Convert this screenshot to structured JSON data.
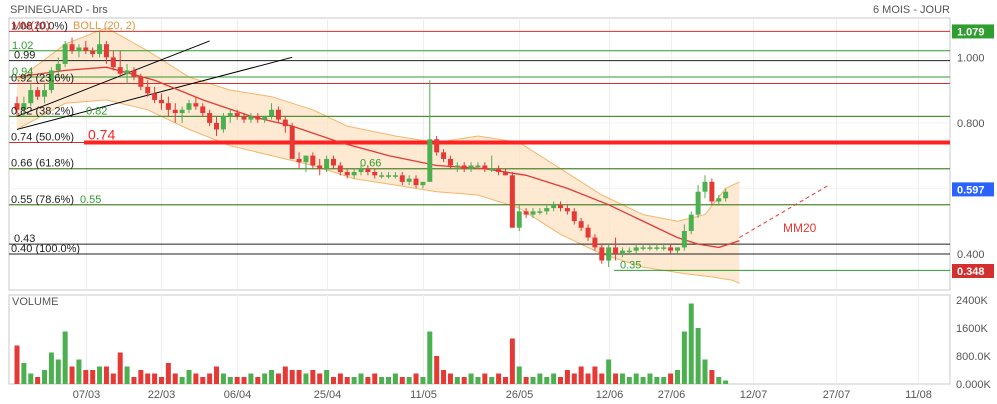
{
  "header": {
    "title": "SPINEGUARD - brs",
    "period": "6 MOIS - JOUR"
  },
  "legend": {
    "mm": "MM(20)",
    "boll": "BOLL (20, 2)"
  },
  "colors": {
    "up": "#4caf50",
    "down": "#e53935",
    "ma": "#e53935",
    "boll_fill": "#fde2c4",
    "boll_line": "#f4b66a",
    "fib": "#d32f2f",
    "support": "#2e9e2e",
    "axis_text": "#555555"
  },
  "price_axis": {
    "ticks": [
      1.0,
      0.8,
      0.6,
      0.4
    ],
    "tick_labels": [
      "1.000",
      "0.800",
      "0.600",
      "0.400"
    ],
    "markers": [
      {
        "label": "1.079",
        "value": 1.079,
        "color": "#2e9e2e"
      },
      {
        "label": "0.597",
        "value": 0.597,
        "color": "#2962ff"
      },
      {
        "label": "0.348",
        "value": 0.348,
        "color": "#d32f2f"
      }
    ]
  },
  "volume_axis": {
    "title": "VOLUME",
    "ticks": [
      0,
      800000,
      1600000,
      2400000
    ],
    "tick_labels": [
      "0.000K",
      "800.0K",
      "1600K",
      "2400K"
    ]
  },
  "dates": [
    "07/03",
    "22/03",
    "06/04",
    "25/04",
    "11/05",
    "26/05",
    "12/06",
    "27/06",
    "12/07",
    "27/07",
    "11/08"
  ],
  "fib_levels": [
    {
      "label": "1.08  (0.0%)",
      "value": 1.079
    },
    {
      "label": "0.92  (23.6%)",
      "value": 0.92
    },
    {
      "label": "0.82  (38.2%)",
      "value": 0.82
    },
    {
      "label": "0.74  (50.0%)",
      "value": 0.74
    },
    {
      "label": "0.66  (61.8%)",
      "value": 0.66
    },
    {
      "label": "0.55  (78.6%)",
      "value": 0.55
    },
    {
      "label": "0.40  (100.0%)",
      "value": 0.4
    }
  ],
  "horizontal_levels": [
    {
      "label": "1.02",
      "value": 1.02,
      "type": "support"
    },
    {
      "label": "0.99",
      "value": 0.99,
      "type": "black"
    },
    {
      "label": "0.94",
      "value": 0.94,
      "type": "support"
    },
    {
      "label": "0.82",
      "value": 0.82,
      "type": "support"
    },
    {
      "label": "0.74",
      "value": 0.74,
      "type": "key"
    },
    {
      "label": "0.66",
      "value": 0.66,
      "type": "support"
    },
    {
      "label": "0.55",
      "value": 0.55,
      "type": "support"
    },
    {
      "label": "0.43",
      "value": 0.43,
      "type": "black"
    },
    {
      "label": "0.35",
      "value": 0.35,
      "type": "support"
    }
  ],
  "annotations": {
    "ma_label": "MM20"
  },
  "chart_data": {
    "type": "candlestick",
    "title": "SPINEGUARD - brs",
    "period": "6 MOIS - JOUR",
    "ylim": [
      0.29,
      1.12
    ],
    "x_tick_labels": [
      "07/03",
      "22/03",
      "06/04",
      "25/04",
      "11/05",
      "26/05",
      "12/06",
      "27/06",
      "12/07",
      "27/07",
      "11/08"
    ],
    "candles": [
      [
        0.86,
        0.88,
        0.82,
        0.84,
        1100000
      ],
      [
        0.84,
        0.88,
        0.82,
        0.86,
        600000
      ],
      [
        0.86,
        0.92,
        0.85,
        0.9,
        300000
      ],
      [
        0.9,
        0.91,
        0.87,
        0.88,
        200000
      ],
      [
        0.88,
        0.92,
        0.86,
        0.9,
        400000
      ],
      [
        0.9,
        0.97,
        0.89,
        0.96,
        900000
      ],
      [
        0.96,
        1.0,
        0.94,
        0.98,
        700000
      ],
      [
        0.98,
        1.05,
        0.97,
        1.04,
        1500000
      ],
      [
        1.04,
        1.06,
        1.01,
        1.02,
        500000
      ],
      [
        1.02,
        1.04,
        1.0,
        1.03,
        700000
      ],
      [
        1.03,
        1.05,
        1.01,
        1.02,
        400000
      ],
      [
        1.02,
        1.03,
        1.0,
        1.01,
        400000
      ],
      [
        1.01,
        1.08,
        1.0,
        1.04,
        500000
      ],
      [
        1.04,
        1.05,
        0.98,
        1.0,
        500000
      ],
      [
        1.0,
        1.02,
        0.96,
        0.97,
        300000
      ],
      [
        0.97,
        1.02,
        0.94,
        0.95,
        900000
      ],
      [
        0.95,
        0.98,
        0.92,
        0.96,
        500000
      ],
      [
        0.96,
        0.97,
        0.93,
        0.94,
        200000
      ],
      [
        0.94,
        0.95,
        0.9,
        0.91,
        400000
      ],
      [
        0.91,
        0.93,
        0.88,
        0.89,
        300000
      ],
      [
        0.89,
        0.91,
        0.86,
        0.87,
        300000
      ],
      [
        0.87,
        0.89,
        0.84,
        0.86,
        200000
      ],
      [
        0.86,
        0.88,
        0.82,
        0.84,
        600000
      ],
      [
        0.84,
        0.86,
        0.8,
        0.83,
        300000
      ],
      [
        0.83,
        0.85,
        0.8,
        0.84,
        200000
      ],
      [
        0.84,
        0.87,
        0.83,
        0.86,
        400000
      ],
      [
        0.86,
        0.88,
        0.84,
        0.85,
        300000
      ],
      [
        0.85,
        0.86,
        0.82,
        0.83,
        200000
      ],
      [
        0.83,
        0.84,
        0.79,
        0.8,
        300000
      ],
      [
        0.8,
        0.82,
        0.76,
        0.78,
        500000
      ],
      [
        0.78,
        0.83,
        0.77,
        0.82,
        300000
      ],
      [
        0.82,
        0.84,
        0.8,
        0.83,
        200000
      ],
      [
        0.83,
        0.84,
        0.81,
        0.82,
        200000
      ],
      [
        0.82,
        0.83,
        0.8,
        0.81,
        200000
      ],
      [
        0.81,
        0.83,
        0.8,
        0.82,
        300000
      ],
      [
        0.82,
        0.83,
        0.8,
        0.81,
        200000
      ],
      [
        0.81,
        0.82,
        0.8,
        0.82,
        300000
      ],
      [
        0.82,
        0.86,
        0.81,
        0.84,
        400000
      ],
      [
        0.84,
        0.85,
        0.8,
        0.81,
        300000
      ],
      [
        0.81,
        0.82,
        0.77,
        0.79,
        500000
      ],
      [
        0.79,
        0.8,
        0.72,
        0.69,
        400000
      ],
      [
        0.69,
        0.71,
        0.66,
        0.68,
        400000
      ],
      [
        0.68,
        0.7,
        0.65,
        0.7,
        300000
      ],
      [
        0.7,
        0.71,
        0.66,
        0.67,
        400000
      ],
      [
        0.67,
        0.69,
        0.64,
        0.66,
        300000
      ],
      [
        0.66,
        0.7,
        0.65,
        0.69,
        400000
      ],
      [
        0.69,
        0.7,
        0.66,
        0.67,
        200000
      ],
      [
        0.67,
        0.68,
        0.64,
        0.65,
        300000
      ],
      [
        0.65,
        0.66,
        0.63,
        0.64,
        200000
      ],
      [
        0.64,
        0.66,
        0.63,
        0.65,
        200000
      ],
      [
        0.65,
        0.67,
        0.64,
        0.66,
        300000
      ],
      [
        0.66,
        0.67,
        0.64,
        0.65,
        200000
      ],
      [
        0.65,
        0.66,
        0.63,
        0.64,
        300000
      ],
      [
        0.64,
        0.65,
        0.63,
        0.64,
        200000
      ],
      [
        0.64,
        0.65,
        0.63,
        0.64,
        200000
      ],
      [
        0.64,
        0.65,
        0.63,
        0.64,
        300000
      ],
      [
        0.64,
        0.65,
        0.61,
        0.62,
        200000
      ],
      [
        0.62,
        0.64,
        0.61,
        0.63,
        200000
      ],
      [
        0.63,
        0.64,
        0.6,
        0.61,
        300000
      ],
      [
        0.61,
        0.62,
        0.6,
        0.62,
        200000
      ],
      [
        0.62,
        0.93,
        0.62,
        0.75,
        1500000
      ],
      [
        0.75,
        0.76,
        0.7,
        0.71,
        800000
      ],
      [
        0.71,
        0.72,
        0.68,
        0.69,
        400000
      ],
      [
        0.69,
        0.7,
        0.66,
        0.67,
        300000
      ],
      [
        0.67,
        0.68,
        0.65,
        0.67,
        200000
      ],
      [
        0.67,
        0.68,
        0.65,
        0.66,
        200000
      ],
      [
        0.66,
        0.68,
        0.65,
        0.67,
        300000
      ],
      [
        0.67,
        0.68,
        0.66,
        0.67,
        200000
      ],
      [
        0.67,
        0.68,
        0.65,
        0.66,
        300000
      ],
      [
        0.66,
        0.7,
        0.65,
        0.66,
        200000
      ],
      [
        0.66,
        0.67,
        0.64,
        0.65,
        300000
      ],
      [
        0.65,
        0.66,
        0.64,
        0.64,
        200000
      ],
      [
        0.64,
        0.65,
        0.51,
        0.48,
        1300000
      ],
      [
        0.48,
        0.55,
        0.47,
        0.53,
        500000
      ],
      [
        0.53,
        0.54,
        0.51,
        0.52,
        200000
      ],
      [
        0.52,
        0.54,
        0.51,
        0.53,
        200000
      ],
      [
        0.53,
        0.54,
        0.52,
        0.53,
        300000
      ],
      [
        0.53,
        0.55,
        0.52,
        0.54,
        200000
      ],
      [
        0.54,
        0.56,
        0.53,
        0.55,
        300000
      ],
      [
        0.55,
        0.56,
        0.53,
        0.54,
        200000
      ],
      [
        0.54,
        0.55,
        0.52,
        0.53,
        400000
      ],
      [
        0.53,
        0.54,
        0.49,
        0.5,
        300000
      ],
      [
        0.5,
        0.51,
        0.47,
        0.48,
        500000
      ],
      [
        0.48,
        0.49,
        0.44,
        0.45,
        300000
      ],
      [
        0.45,
        0.46,
        0.41,
        0.42,
        500000
      ],
      [
        0.42,
        0.43,
        0.37,
        0.38,
        300000
      ],
      [
        0.38,
        0.43,
        0.36,
        0.42,
        700000
      ],
      [
        0.42,
        0.45,
        0.38,
        0.4,
        300000
      ],
      [
        0.4,
        0.42,
        0.39,
        0.41,
        300000
      ],
      [
        0.41,
        0.42,
        0.4,
        0.41,
        200000
      ],
      [
        0.41,
        0.43,
        0.4,
        0.42,
        300000
      ],
      [
        0.42,
        0.43,
        0.41,
        0.42,
        200000
      ],
      [
        0.42,
        0.43,
        0.41,
        0.42,
        300000
      ],
      [
        0.42,
        0.43,
        0.41,
        0.42,
        200000
      ],
      [
        0.42,
        0.43,
        0.41,
        0.42,
        200000
      ],
      [
        0.42,
        0.43,
        0.4,
        0.41,
        300000
      ],
      [
        0.41,
        0.42,
        0.4,
        0.42,
        400000
      ],
      [
        0.42,
        0.49,
        0.41,
        0.47,
        1500000
      ],
      [
        0.47,
        0.53,
        0.46,
        0.52,
        2300000
      ],
      [
        0.52,
        0.61,
        0.51,
        0.59,
        1600000
      ],
      [
        0.59,
        0.64,
        0.57,
        0.62,
        700000
      ],
      [
        0.62,
        0.63,
        0.55,
        0.56,
        400000
      ],
      [
        0.56,
        0.58,
        0.55,
        0.57,
        200000
      ],
      [
        0.57,
        0.6,
        0.56,
        0.59,
        100000
      ]
    ],
    "ma20": [
      [
        0,
        0.94
      ],
      [
        7,
        0.96
      ],
      [
        13,
        0.97
      ],
      [
        20,
        0.93
      ],
      [
        27,
        0.87
      ],
      [
        34,
        0.82
      ],
      [
        40,
        0.79
      ],
      [
        47,
        0.74
      ],
      [
        54,
        0.7
      ],
      [
        61,
        0.67
      ],
      [
        68,
        0.66
      ],
      [
        74,
        0.64
      ],
      [
        80,
        0.6
      ],
      [
        86,
        0.55
      ],
      [
        92,
        0.49
      ],
      [
        96,
        0.45
      ],
      [
        99,
        0.43
      ],
      [
        102,
        0.42
      ],
      [
        105,
        0.44
      ]
    ],
    "boll_upper": [
      [
        0,
        0.93
      ],
      [
        7,
        1.04
      ],
      [
        13,
        1.09
      ],
      [
        19,
        1.02
      ],
      [
        25,
        0.94
      ],
      [
        31,
        0.9
      ],
      [
        37,
        0.88
      ],
      [
        43,
        0.84
      ],
      [
        48,
        0.79
      ],
      [
        55,
        0.76
      ],
      [
        61,
        0.74
      ],
      [
        67,
        0.76
      ],
      [
        73,
        0.74
      ],
      [
        79,
        0.66
      ],
      [
        85,
        0.58
      ],
      [
        91,
        0.52
      ],
      [
        96,
        0.5
      ],
      [
        100,
        0.52
      ],
      [
        103,
        0.6
      ],
      [
        105,
        0.62
      ]
    ],
    "boll_lower": [
      [
        0,
        0.78
      ],
      [
        7,
        0.86
      ],
      [
        13,
        0.87
      ],
      [
        19,
        0.84
      ],
      [
        25,
        0.78
      ],
      [
        31,
        0.73
      ],
      [
        37,
        0.7
      ],
      [
        43,
        0.67
      ],
      [
        49,
        0.63
      ],
      [
        55,
        0.61
      ],
      [
        61,
        0.59
      ],
      [
        67,
        0.58
      ],
      [
        73,
        0.54
      ],
      [
        79,
        0.46
      ],
      [
        85,
        0.4
      ],
      [
        91,
        0.36
      ],
      [
        97,
        0.34
      ],
      [
        101,
        0.33
      ],
      [
        104,
        0.32
      ],
      [
        105,
        0.31
      ]
    ],
    "trendlines": [
      {
        "from": [
          0,
          0.82
        ],
        "to": [
          28,
          1.05
        ],
        "color": "#000000"
      },
      {
        "from": [
          0,
          0.78
        ],
        "to": [
          40,
          1.0
        ],
        "color": "#000000"
      },
      {
        "from": [
          105,
          0.45
        ],
        "to": [
          118,
          0.61
        ],
        "color": "#e53935",
        "style": "dashed"
      }
    ]
  }
}
